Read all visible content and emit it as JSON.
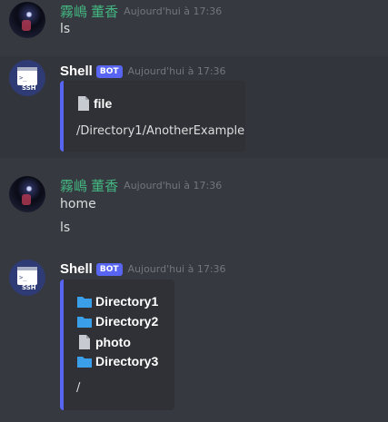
{
  "messages": [
    {
      "author": "霧嶋 董香",
      "timestamp": "Aujourd'hui à 17:36",
      "lines": [
        "ls"
      ]
    },
    {
      "author": "Shell",
      "bot_tag": "BOT",
      "timestamp": "Aujourd'hui à 17:36",
      "embed": {
        "items": [
          {
            "icon": "file-icon",
            "name": "file"
          }
        ],
        "path": "/Directory1/AnotherExample"
      }
    },
    {
      "author": "霧嶋 董香",
      "timestamp": "Aujourd'hui à 17:36",
      "lines": [
        "home",
        "ls"
      ]
    },
    {
      "author": "Shell",
      "bot_tag": "BOT",
      "timestamp": "Aujourd'hui à 17:36",
      "embed": {
        "items": [
          {
            "icon": "folder-icon",
            "name": "Directory1"
          },
          {
            "icon": "folder-icon",
            "name": "Directory2"
          },
          {
            "icon": "file-icon",
            "name": "photo"
          },
          {
            "icon": "folder-icon",
            "name": "Directory3"
          }
        ],
        "path": "/"
      }
    }
  ],
  "colors": {
    "background": "#36393f",
    "embed_background": "#2f3136",
    "embed_accent": "#5865f2",
    "user_name": "#43b581",
    "bot_name": "#ffffff",
    "timestamp": "#72767d",
    "folder": "#3b9ee8",
    "file": "#c7cbd1"
  }
}
